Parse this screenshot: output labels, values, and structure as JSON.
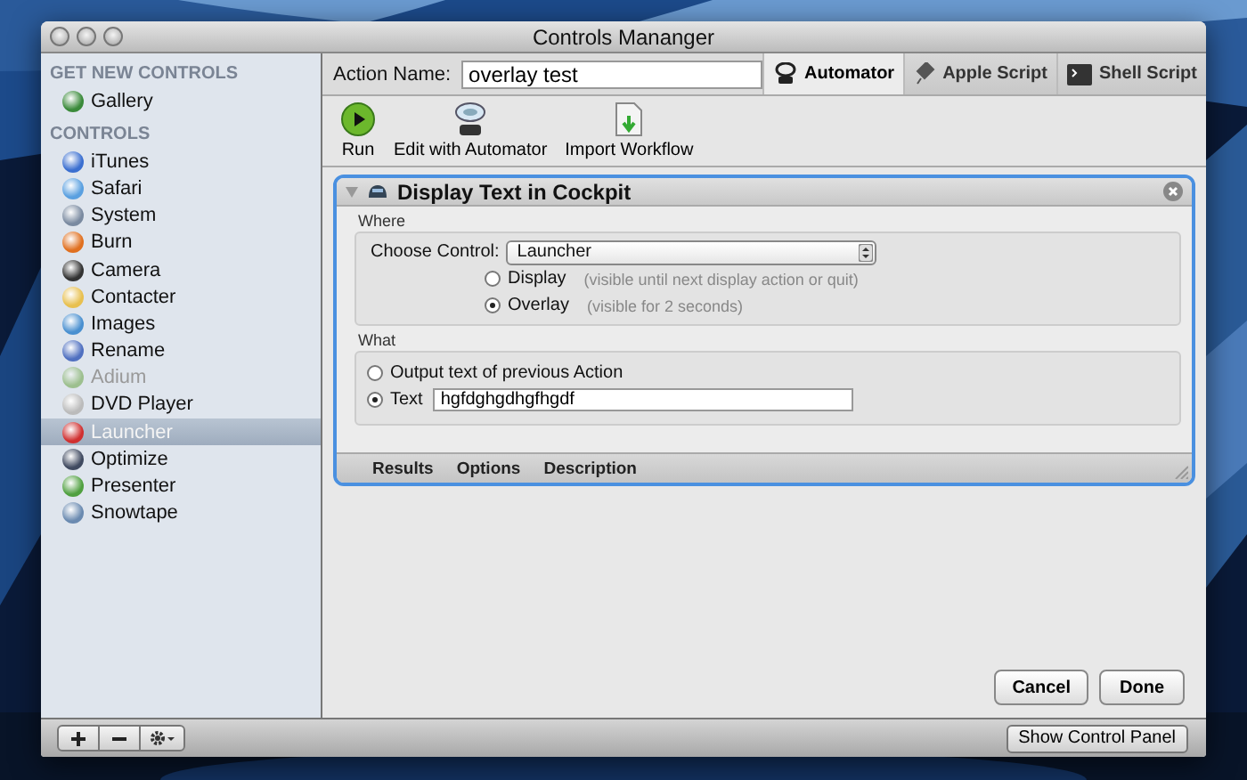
{
  "window": {
    "title": "Controls Mananger"
  },
  "sidebar": {
    "sections": [
      {
        "header": "GET NEW CONTROLS",
        "items": [
          {
            "label": "Gallery",
            "selected": false,
            "disabled": false
          }
        ]
      },
      {
        "header": "CONTROLS",
        "items": [
          {
            "label": "iTunes",
            "selected": false,
            "disabled": false
          },
          {
            "label": "Safari",
            "selected": false,
            "disabled": false
          },
          {
            "label": "System",
            "selected": false,
            "disabled": false
          },
          {
            "label": "Burn",
            "selected": false,
            "disabled": false
          },
          {
            "label": "Camera",
            "selected": false,
            "disabled": false
          },
          {
            "label": "Contacter",
            "selected": false,
            "disabled": false
          },
          {
            "label": "Images",
            "selected": false,
            "disabled": false
          },
          {
            "label": "Rename",
            "selected": false,
            "disabled": false
          },
          {
            "label": "Adium",
            "selected": false,
            "disabled": true
          },
          {
            "label": "DVD Player",
            "selected": false,
            "disabled": false
          },
          {
            "label": "Launcher",
            "selected": true,
            "disabled": false
          },
          {
            "label": "Optimize",
            "selected": false,
            "disabled": false
          },
          {
            "label": "Presenter",
            "selected": false,
            "disabled": false
          },
          {
            "label": "Snowtape",
            "selected": false,
            "disabled": false
          }
        ]
      }
    ]
  },
  "action_name": {
    "label": "Action Name:",
    "value": "overlay test"
  },
  "tabs": [
    {
      "label": "Automator",
      "selected": true
    },
    {
      "label": "Apple Script",
      "selected": false
    },
    {
      "label": "Shell Script",
      "selected": false
    }
  ],
  "toolbar": [
    {
      "label": "Run"
    },
    {
      "label": "Edit with Automator"
    },
    {
      "label": "Import Workflow"
    }
  ],
  "action": {
    "title": "Display Text in Cockpit",
    "where": {
      "label": "Where",
      "choose_label": "Choose Control:",
      "choose_value": "Launcher",
      "options": [
        {
          "label": "Display",
          "hint": "(visible until next display action or quit)",
          "selected": false
        },
        {
          "label": "Overlay",
          "hint": "(visible for 2 seconds)",
          "selected": true
        }
      ]
    },
    "what": {
      "label": "What",
      "options": [
        {
          "kind": "plain",
          "label": "Output text of previous Action",
          "selected": false
        },
        {
          "kind": "field",
          "label": "Text",
          "selected": true,
          "value": "hgfdghgdhgfhgdf"
        }
      ]
    },
    "footer_tabs": [
      "Results",
      "Options",
      "Description"
    ]
  },
  "buttons": [
    "Cancel",
    "Done"
  ],
  "bottom_bar": {
    "button": "Show Control Panel"
  }
}
